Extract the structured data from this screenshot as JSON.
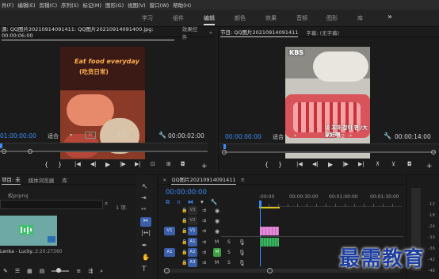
{
  "menu": [
    "件(F)",
    "编辑(E)",
    "剪辑(C)",
    "序列(S)",
    "标记(M)",
    "图形(G)",
    "视图(V)",
    "窗口(W)",
    "帮助(H)"
  ],
  "workspace_tabs": [
    "学习",
    "组件",
    "编辑",
    "颜色",
    "效果",
    "音频",
    "图形",
    "库"
  ],
  "source": {
    "tab_label": "源: QQ图片20210914091411: QQ图片20210914091400.jpg: 00:00:06:00",
    "effects_tab": "效果控件",
    "timecode": "01:00:00:00",
    "fit": "适合",
    "ratio": "1/2",
    "duration": "00:00:02:00",
    "image_caption_line1": "Eat food everyday",
    "image_caption_line2": "(吃货日常)"
  },
  "program": {
    "tab_label": "节目: QQ图片20210914091411",
    "subtitle_tab": "字幕: (无字幕)",
    "timecode": "00:00:00:00",
    "fit": "适合",
    "ratio": "1/2",
    "duration": "00:00:14:00",
    "badge": "KBS",
    "sign_text": "네 꼬마 잡이 편 /大家好啊"
  },
  "project": {
    "tab_label": "项目: 未",
    "media_tab": "媒体浏览器",
    "lib_tab": "库",
    "file": "权prproj",
    "count": "1 项.",
    "clip_name": "Lenka - Lucky...",
    "clip_duration": "3:20:27360"
  },
  "timeline": {
    "tab_label": "QQ图片20210914091411",
    "timecode": "00:00:00:00",
    "ruler": [
      ":00:00",
      "00:00:30:00",
      "00:01:00:00",
      "00:01:30:00"
    ],
    "tracks": [
      {
        "src": "",
        "name": "V3",
        "locked": true
      },
      {
        "src": "",
        "name": "V2",
        "locked": true
      },
      {
        "src": "V1",
        "name": "V1",
        "locked": true
      },
      {
        "src": "",
        "name": "A1",
        "locked": true
      },
      {
        "src": "A1",
        "name": "A2",
        "locked": true
      },
      {
        "src": "",
        "name": "A3",
        "locked": true
      }
    ],
    "track_btn_m": "M",
    "track_btn_s": "S"
  },
  "watermark": "最需教育",
  "colors": {
    "accent": "#3d8cf5",
    "clip_pink": "#e58ad9",
    "clip_green": "#3fbf6a",
    "panel": "#1b1b1b"
  }
}
